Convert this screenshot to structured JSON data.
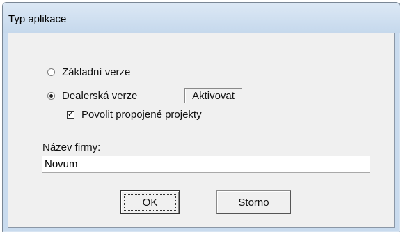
{
  "dialog": {
    "title": "Typ aplikace",
    "options": {
      "basic_label": "Základní verze",
      "dealer_label": "Dealerská verze",
      "selected": "dealer"
    },
    "activate_button": "Aktivovat",
    "checkbox": {
      "label": "Povolit propojené projekty",
      "checked": true,
      "mark": "✓"
    },
    "company": {
      "label": "Název firmy:",
      "value": "Novum"
    },
    "ok_button": "OK",
    "cancel_button": "Storno"
  }
}
